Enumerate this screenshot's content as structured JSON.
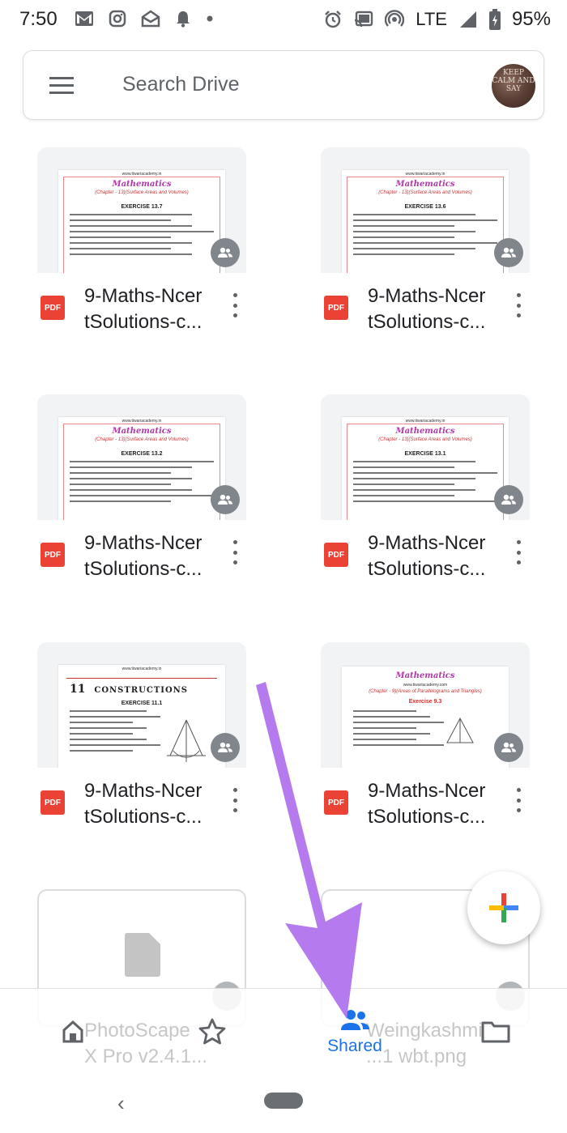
{
  "status_bar": {
    "time": "7:50",
    "network": "LTE",
    "battery": "95%",
    "left_icons": [
      "gmail-icon",
      "instagram-icon",
      "mail-open-icon",
      "bell-icon",
      "dot-icon"
    ],
    "right_icons": [
      "alarm-icon",
      "cast-icon",
      "hotspot-icon",
      "signal-icon",
      "battery-icon"
    ]
  },
  "search": {
    "placeholder": "Search Drive",
    "avatar_text": "KEEP CALM AND SAY"
  },
  "files": [
    {
      "name": "9-Maths-NcertSolutions-c...",
      "line1": "9-Maths-Ncer",
      "line2": "tSolutions-c...",
      "type_label": "PDF",
      "thumb_title": "Mathematics",
      "thumb_sub": "(Chapter - 13)(Surface Areas and Volumes)",
      "thumb_exercise": "EXERCISE 13.7",
      "thumb_site": "www.tiwariacademy.in"
    },
    {
      "name": "9-Maths-NcertSolutions-c...",
      "line1": "9-Maths-Ncer",
      "line2": "tSolutions-c...",
      "type_label": "PDF",
      "thumb_title": "Mathematics",
      "thumb_sub": "(Chapter - 13)(Surface Areas and Volumes)",
      "thumb_exercise": "EXERCISE 13.6",
      "thumb_site": "www.tiwariacademy.in"
    },
    {
      "name": "9-Maths-NcertSolutions-c...",
      "line1": "9-Maths-Ncer",
      "line2": "tSolutions-c...",
      "type_label": "PDF",
      "thumb_title": "Mathematics",
      "thumb_sub": "(Chapter - 13)(Surface Areas and Volumes)",
      "thumb_exercise": "EXERCISE 13.2",
      "thumb_site": "www.tiwariacademy.in"
    },
    {
      "name": "9-Maths-NcertSolutions-c...",
      "line1": "9-Maths-Ncer",
      "line2": "tSolutions-c...",
      "type_label": "PDF",
      "thumb_title": "Mathematics",
      "thumb_sub": "(Chapter - 13)(Surface Areas and Volumes)",
      "thumb_exercise": "EXERCISE 13.1",
      "thumb_site": "www.tiwariacademy.in"
    },
    {
      "name": "9-Maths-NcertSolutions-c...",
      "line1": "9-Maths-Ncer",
      "line2": "tSolutions-c...",
      "type_label": "PDF",
      "thumb_chapter_num": "11",
      "thumb_chapter": "CONSTRUCTIONS",
      "thumb_exercise": "EXERCISE 11.1",
      "thumb_site": "www.tiwariacademy.in"
    },
    {
      "name": "9-Maths-NcertSolutions-c...",
      "line1": "9-Maths-Ncer",
      "line2": "tSolutions-c...",
      "type_label": "PDF",
      "thumb_title": "Mathematics",
      "thumb_sub": "(Chapter - 9)(Areas of Parallelograms and Triangles)",
      "thumb_exercise": "Exercise 9.3",
      "thumb_site": "www.tiwariacademy.com"
    }
  ],
  "partial_files": [
    {
      "line1": "PhotoScape",
      "line2": "X Pro v2.4.1..."
    },
    {
      "line1": "Weingkashmi",
      "line2": "...1 wbt.png"
    }
  ],
  "fab": {
    "icon": "plus-icon",
    "colors": [
      "#ea4335",
      "#fbbc04",
      "#34a853",
      "#4285f4"
    ]
  },
  "bottom_nav": {
    "items": [
      {
        "icon": "home-icon",
        "label": ""
      },
      {
        "icon": "star-icon",
        "label": ""
      },
      {
        "icon": "shared-icon",
        "label": "Shared"
      },
      {
        "icon": "folder-icon",
        "label": ""
      }
    ],
    "active_color": "#1a73e8"
  },
  "annotation": {
    "arrow_color": "#b57bee"
  }
}
